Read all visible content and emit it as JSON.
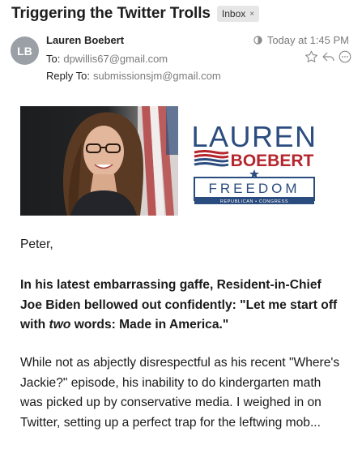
{
  "email": {
    "subject": "Triggering the Twitter Trolls",
    "label": "Inbox",
    "label_close": "×",
    "avatar_initials": "LB",
    "from_name": "Lauren Boebert",
    "to_label": "To:",
    "to_value": "dpwillis67@gmail.com",
    "reply_to_label": "Reply To:",
    "reply_to_value": "submissionsjm@gmail.com",
    "date": "Today at 1:45 PM"
  },
  "banner": {
    "logo_line1": "LAUREN",
    "logo_line2": "BOEBERT",
    "logo_line3": "FREEDOM",
    "logo_line4": "REPUBLICAN • CONGRESS"
  },
  "content": {
    "greeting": "Peter,",
    "bold_part1": "In his latest embarrassing gaffe, Resident-in-Chief Joe Biden bellowed out confidently: \"Let me start off with ",
    "bold_italic": "two",
    "bold_part2": " words: Made in America.\"",
    "para": "While not as abjectly disrespectful as his recent \"Where's Jackie?\" episode, his inability to do kindergarten math was picked up by conservative media. I weighed in on Twitter, setting up a perfect trap for the leftwing mob..."
  },
  "icons": {
    "importance": "half-circle-icon",
    "star": "star-icon",
    "reply": "reply-icon",
    "more": "more-icon"
  },
  "colors": {
    "logo_blue": "#2b4c7e",
    "logo_red": "#b5252c",
    "avatar_bg": "#9aa0a6",
    "badge_bg": "#e6e6e6"
  }
}
